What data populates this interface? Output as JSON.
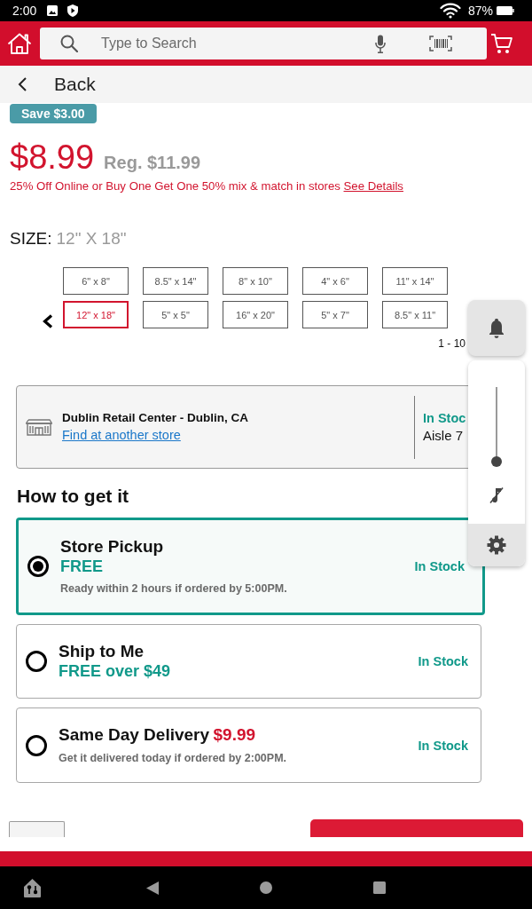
{
  "status_bar": {
    "time": "2:00",
    "battery": "87%"
  },
  "header": {
    "search": {
      "placeholder": "Type to Search"
    }
  },
  "back_bar": {
    "label": "Back"
  },
  "product": {
    "badge": "Save $3.00",
    "price": "$8.99",
    "regular_price": "Reg. $11.99",
    "promo": "25% Off Online or Buy One Get One 50% mix & match in stores",
    "promo_link": "See Details"
  },
  "size": {
    "label": "SIZE:",
    "value": "12\" X 18\"",
    "options": [
      {
        "label": "6\" x 8\"",
        "selected": false
      },
      {
        "label": "8.5\" x 14\"",
        "selected": false
      },
      {
        "label": "8\" x 10\"",
        "selected": false
      },
      {
        "label": "4\" x 6\"",
        "selected": false
      },
      {
        "label": "11\" x 14\"",
        "selected": false
      },
      {
        "label": "12\" x 18\"",
        "selected": true
      },
      {
        "label": "5\" x 5\"",
        "selected": false
      },
      {
        "label": "16\" x 20\"",
        "selected": false
      },
      {
        "label": "5\" x 7\"",
        "selected": false
      },
      {
        "label": "8.5\" x 11\"",
        "selected": false
      }
    ],
    "range": "1 - 10"
  },
  "store": {
    "name": "Dublin Retail Center - Dublin, CA",
    "link": "Find at another store",
    "stock": "In Stoc",
    "aisle": "Aisle 7"
  },
  "fulfillment": {
    "title": "How to get it",
    "options": [
      {
        "kind": "free",
        "title": "Store Pickup",
        "price": "FREE",
        "note": "Ready within 2 hours if ordered by 5:00PM.",
        "stock": "In Stock",
        "selected": true
      },
      {
        "kind": "free",
        "title": "Ship to Me",
        "price": "FREE over $49",
        "stock": "In Stock",
        "selected": false
      },
      {
        "kind": "fee",
        "title": "Same Day Delivery",
        "price": "$9.99",
        "note": "Get it delivered today if ordered by 2:00PM.",
        "stock": "In Stock",
        "selected": false
      }
    ]
  },
  "volume_panel": {
    "level": 0
  }
}
